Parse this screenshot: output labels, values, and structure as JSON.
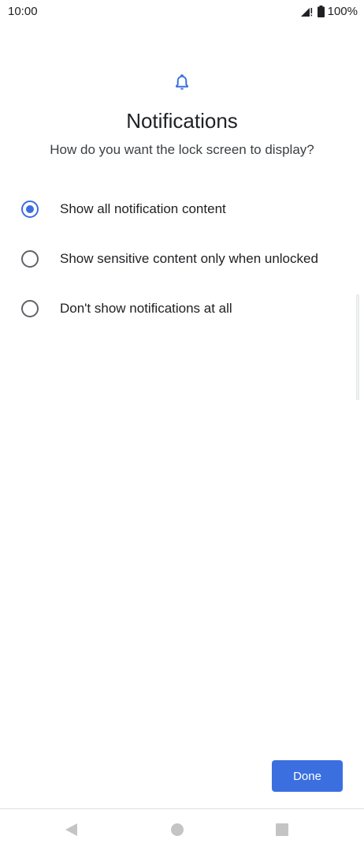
{
  "status_bar": {
    "time": "10:00",
    "battery": "100%",
    "icons": [
      "signal-icon",
      "battery-icon"
    ]
  },
  "header": {
    "icon": "bell-icon",
    "title": "Notifications",
    "subtitle": "How do you want the lock screen to display?"
  },
  "options": [
    {
      "label": "Show all notification content",
      "selected": true
    },
    {
      "label": "Show sensitive content only when unlocked",
      "selected": false
    },
    {
      "label": "Don't show notifications at all",
      "selected": false
    }
  ],
  "footer": {
    "done_label": "Done"
  },
  "nav": {
    "icons": [
      "back-icon",
      "home-icon",
      "recents-icon"
    ]
  },
  "colors": {
    "accent": "#3b6fe0",
    "text": "#202124",
    "radio_unchecked": "#5f6368",
    "nav_icon": "#c4c4c4"
  }
}
